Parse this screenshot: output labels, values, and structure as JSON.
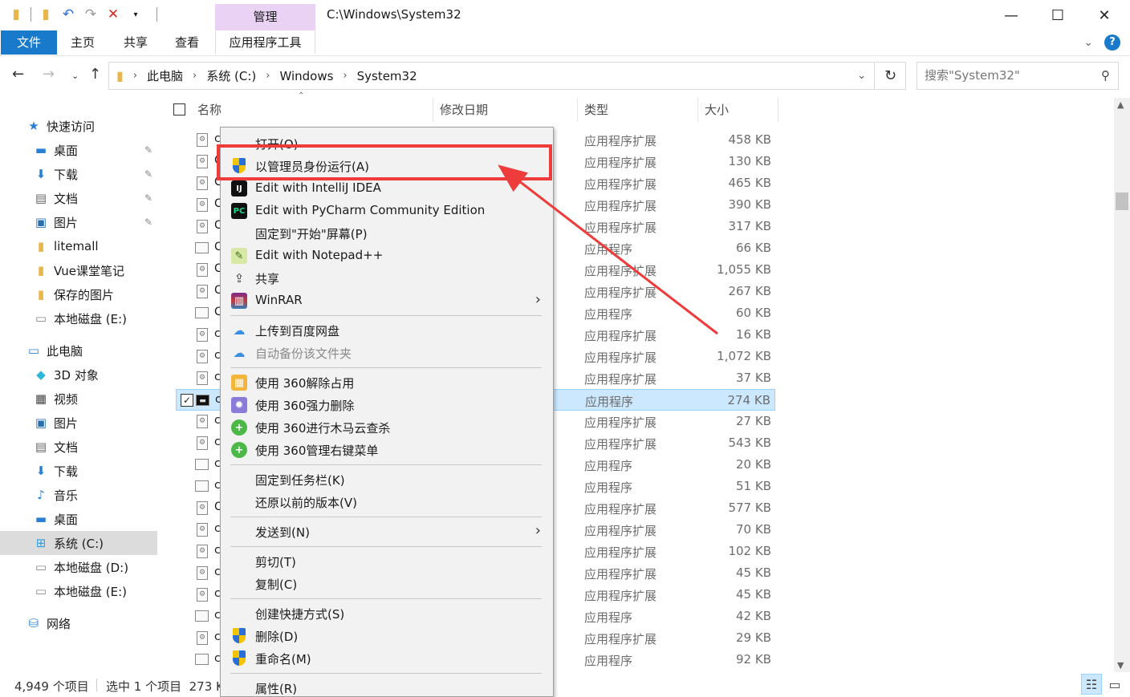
{
  "window": {
    "title": "C:\\Windows\\System32",
    "contextual_tab": "管理",
    "controls": {
      "minimize": "—",
      "maximize": "☐",
      "close": "✕"
    }
  },
  "ribbon": {
    "tabs": [
      "文件",
      "主页",
      "共享",
      "查看",
      "应用程序工具"
    ]
  },
  "address": {
    "segments": [
      "此电脑",
      "系统 (C:)",
      "Windows",
      "System32"
    ],
    "search_placeholder": "搜索\"System32\""
  },
  "sidebar": {
    "items": [
      {
        "label": "快速访问",
        "icon": "star-icon"
      },
      {
        "label": "桌面",
        "icon": "desktop-icon",
        "pinned": true
      },
      {
        "label": "下载",
        "icon": "download-icon",
        "pinned": true
      },
      {
        "label": "文档",
        "icon": "document-icon",
        "pinned": true
      },
      {
        "label": "图片",
        "icon": "picture-icon",
        "pinned": true
      },
      {
        "label": "litemall",
        "icon": "folder-icon"
      },
      {
        "label": "Vue课堂笔记",
        "icon": "folder-icon"
      },
      {
        "label": "保存的图片",
        "icon": "folder-icon"
      },
      {
        "label": "本地磁盘 (E:)",
        "icon": "drive-icon"
      },
      {
        "label": "此电脑",
        "icon": "computer-icon"
      },
      {
        "label": "3D 对象",
        "icon": "cube-icon"
      },
      {
        "label": "视频",
        "icon": "video-icon"
      },
      {
        "label": "图片",
        "icon": "picture-icon"
      },
      {
        "label": "文档",
        "icon": "document-icon"
      },
      {
        "label": "下载",
        "icon": "download-icon"
      },
      {
        "label": "音乐",
        "icon": "music-icon"
      },
      {
        "label": "桌面",
        "icon": "desktop-icon"
      },
      {
        "label": "系统 (C:)",
        "icon": "windows-drive-icon",
        "selected": true
      },
      {
        "label": "本地磁盘 (D:)",
        "icon": "drive-icon"
      },
      {
        "label": "本地磁盘 (E:)",
        "icon": "drive-icon"
      },
      {
        "label": "网络",
        "icon": "network-icon"
      }
    ]
  },
  "columns": {
    "name": "名称",
    "modified": "修改日期",
    "type": "类型",
    "size": "大小"
  },
  "files": [
    {
      "name": "c",
      "type": "应用程序扩展",
      "size": "458 KB",
      "icon": "dll"
    },
    {
      "name": "C",
      "type": "应用程序扩展",
      "size": "130 KB",
      "icon": "dll"
    },
    {
      "name": "C",
      "type": "应用程序扩展",
      "size": "465 KB",
      "icon": "dll"
    },
    {
      "name": "C",
      "type": "应用程序扩展",
      "size": "390 KB",
      "icon": "dll"
    },
    {
      "name": "C",
      "type": "应用程序扩展",
      "size": "317 KB",
      "icon": "dll"
    },
    {
      "name": "C",
      "type": "应用程序",
      "size": "66 KB",
      "icon": "exe"
    },
    {
      "name": "C",
      "type": "应用程序扩展",
      "size": "1,055 KB",
      "icon": "dll"
    },
    {
      "name": "C",
      "type": "应用程序扩展",
      "size": "267 KB",
      "icon": "dll"
    },
    {
      "name": "C",
      "type": "应用程序",
      "size": "60 KB",
      "icon": "exe"
    },
    {
      "name": "c",
      "type": "应用程序扩展",
      "size": "16 KB",
      "icon": "dll"
    },
    {
      "name": "c",
      "type": "应用程序扩展",
      "size": "1,072 KB",
      "icon": "dll"
    },
    {
      "name": "c",
      "type": "应用程序扩展",
      "size": "37 KB",
      "icon": "dll"
    },
    {
      "name": "c",
      "type": "应用程序",
      "size": "274 KB",
      "icon": "cmd",
      "selected": true
    },
    {
      "name": "c",
      "type": "应用程序扩展",
      "size": "27 KB",
      "icon": "dll"
    },
    {
      "name": "c",
      "type": "应用程序扩展",
      "size": "543 KB",
      "icon": "dll"
    },
    {
      "name": "c",
      "type": "应用程序",
      "size": "20 KB",
      "icon": "exe"
    },
    {
      "name": "c",
      "type": "应用程序",
      "size": "51 KB",
      "icon": "exe"
    },
    {
      "name": "C",
      "type": "应用程序扩展",
      "size": "577 KB",
      "icon": "dll"
    },
    {
      "name": "c",
      "type": "应用程序扩展",
      "size": "70 KB",
      "icon": "dll"
    },
    {
      "name": "c",
      "type": "应用程序扩展",
      "size": "102 KB",
      "icon": "dll"
    },
    {
      "name": "c",
      "type": "应用程序扩展",
      "size": "45 KB",
      "icon": "dll"
    },
    {
      "name": "c",
      "type": "应用程序扩展",
      "size": "45 KB",
      "icon": "dll"
    },
    {
      "name": "c",
      "type": "应用程序",
      "size": "42 KB",
      "icon": "exe"
    },
    {
      "name": "c",
      "type": "应用程序扩展",
      "size": "29 KB",
      "icon": "dll"
    },
    {
      "name": "c",
      "type": "应用程序",
      "size": "92 KB",
      "icon": "exe"
    }
  ],
  "status": {
    "count": "4,949 个项目",
    "selection": "选中 1 个项目  273 K"
  },
  "context_menu": {
    "items": [
      {
        "label": "打开(O)",
        "icon": ""
      },
      {
        "label": "以管理员身份运行(A)",
        "icon": "uac-shield-icon",
        "highlighted": true
      },
      {
        "label": "Edit with IntelliJ IDEA",
        "icon": "intellij-icon"
      },
      {
        "label": "Edit with PyCharm Community Edition",
        "icon": "pycharm-icon"
      },
      {
        "label": "固定到\"开始\"屏幕(P)",
        "icon": ""
      },
      {
        "label": "Edit with Notepad++",
        "icon": "notepadpp-icon"
      },
      {
        "label": "共享",
        "icon": "share-icon"
      },
      {
        "label": "WinRAR",
        "icon": "winrar-icon",
        "submenu": true
      },
      {
        "separator": true
      },
      {
        "label": "上传到百度网盘",
        "icon": "baidu-cloud-icon"
      },
      {
        "label": "自动备份该文件夹",
        "icon": "baidu-cloud-icon",
        "disabled": true
      },
      {
        "separator": true
      },
      {
        "label": "使用 360解除占用",
        "icon": "360-unlock-icon"
      },
      {
        "label": "使用 360强力删除",
        "icon": "360-delete-icon"
      },
      {
        "label": "使用 360进行木马云查杀",
        "icon": "360-scan-icon"
      },
      {
        "label": "使用 360管理右键菜单",
        "icon": "360-menu-icon"
      },
      {
        "separator": true
      },
      {
        "label": "固定到任务栏(K)",
        "icon": ""
      },
      {
        "label": "还原以前的版本(V)",
        "icon": ""
      },
      {
        "separator": true
      },
      {
        "label": "发送到(N)",
        "icon": "",
        "submenu": true
      },
      {
        "separator": true
      },
      {
        "label": "剪切(T)",
        "icon": ""
      },
      {
        "label": "复制(C)",
        "icon": ""
      },
      {
        "separator": true
      },
      {
        "label": "创建快捷方式(S)",
        "icon": ""
      },
      {
        "label": "删除(D)",
        "icon": "uac-shield-icon"
      },
      {
        "label": "重命名(M)",
        "icon": "uac-shield-icon"
      },
      {
        "separator": true
      },
      {
        "label": "属性(R)",
        "icon": ""
      }
    ]
  },
  "colors": {
    "accent": "#1979ca",
    "selection": "#cce8ff",
    "annotation": "#ee3b3b",
    "contextual_tab": "#ead2f5"
  }
}
